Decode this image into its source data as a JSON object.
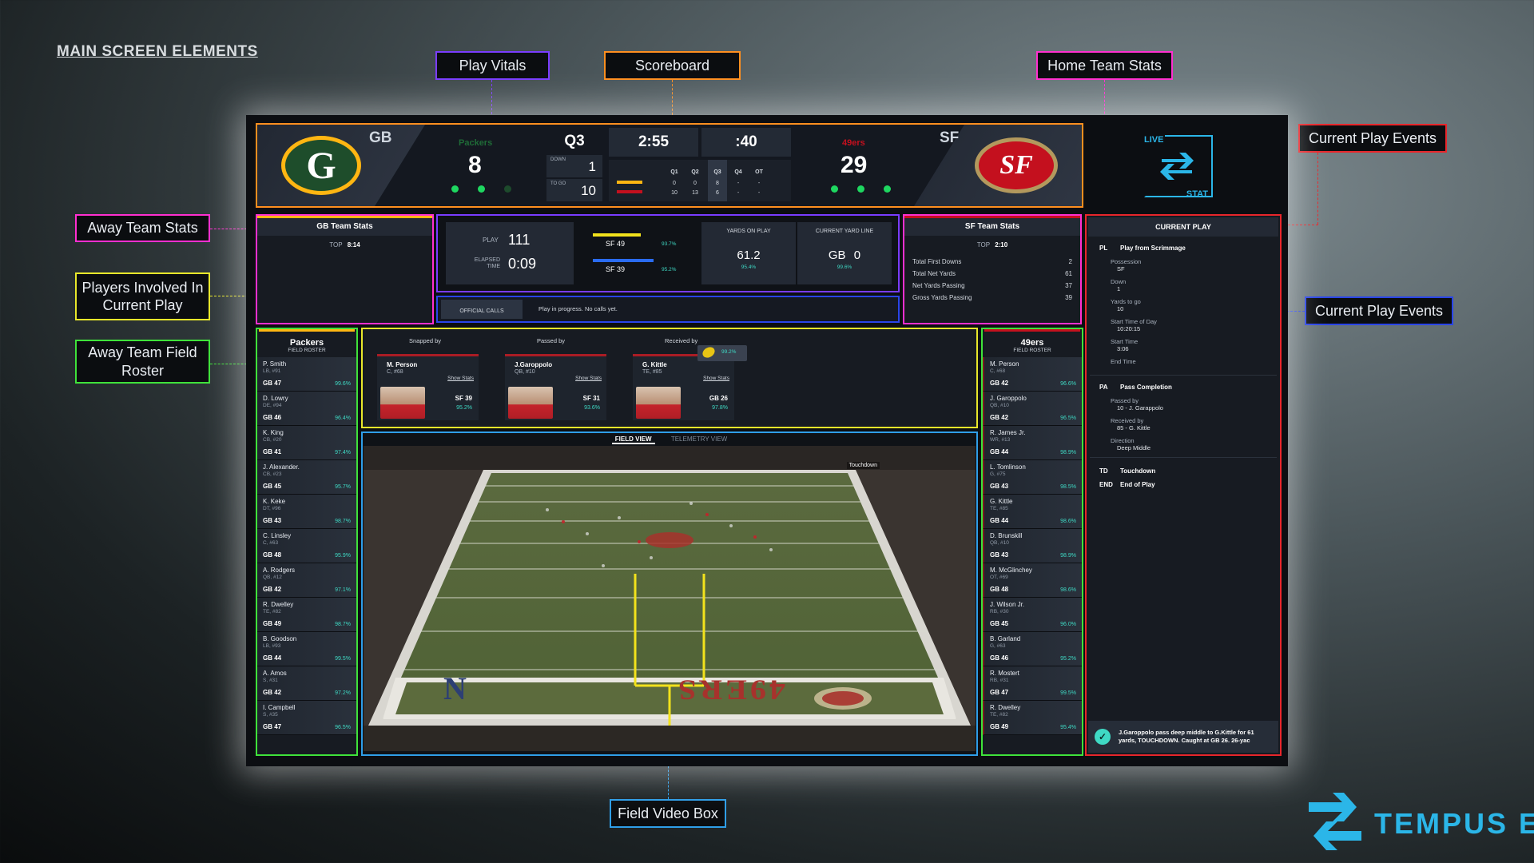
{
  "heading": "MAIN SCREEN ELEMENTS",
  "callouts": {
    "play_vitals": "Play Vitals",
    "scoreboard": "Scoreboard",
    "home_team_stats": "Home Team Stats",
    "current_play_events_top": "Current Play Events",
    "current_play_events_right": "Current Play Events",
    "away_team_stats": "Away Team Stats",
    "players_involved": "Players Involved In Current Play",
    "away_team_field_roster": "Away Team Field Roster",
    "field_video_box": "Field Video Box"
  },
  "colors": {
    "scoreboard": "#ff8f1f",
    "play_vitals": "#7a3cff",
    "team_stats": "#ff2fd0",
    "current_play": "#e8262b",
    "players_involved": "#e8e72a",
    "roster": "#3fe23a",
    "field_video": "#2f9ee8",
    "official_calls": "#2a45e8",
    "teal": "#3fd9c4"
  },
  "scoreboard": {
    "away": {
      "abbr": "GB",
      "name": "Packers",
      "score": "8",
      "logo_letter": "G"
    },
    "home": {
      "abbr": "SF",
      "name": "49ers",
      "score": "29",
      "logo_letter": "SF"
    },
    "quarter": "Q3",
    "down_label": "DOWN",
    "down": "1",
    "togo_label": "TO GO",
    "togo": "10",
    "game_clock": "2:55",
    "play_clock": ":40",
    "quarters_header": [
      "Q1",
      "Q2",
      "Q3",
      "Q4",
      "OT"
    ],
    "away_quarters": [
      "0",
      "0",
      "8",
      "-",
      "-"
    ],
    "home_quarters": [
      "10",
      "13",
      "6",
      "-",
      "-"
    ],
    "away_timeouts_remaining": 2,
    "home_timeouts_remaining": 3
  },
  "live_stat": {
    "top": "LIVE",
    "bottom": "STAT"
  },
  "away_stats": {
    "title": "GB Team Stats",
    "top_label": "TOP",
    "top_value": "8:14"
  },
  "home_stats": {
    "title": "SF Team Stats",
    "top_label": "TOP",
    "top_value": "2:10",
    "rows": [
      {
        "label": "Total First Downs",
        "value": "2"
      },
      {
        "label": "Total Net Yards",
        "value": "61"
      },
      {
        "label": "Net Yards Passing",
        "value": "37"
      },
      {
        "label": "Gross Yards Passing",
        "value": "39"
      }
    ]
  },
  "play_vitals": {
    "play_label": "PLAY",
    "play_value": "111",
    "elapsed_label": "ELAPSED TIME",
    "elapsed_value": "0:09",
    "bar1_label": "SF 49",
    "bar1_pct": "93.7%",
    "bar2_label": "SF 39",
    "bar2_pct": "95.2%",
    "yards_label": "YARDS ON PLAY",
    "yards_value": "61.2",
    "yards_pct": "95.4%",
    "yardline_label": "CURRENT YARD LINE",
    "yardline_team": "GB",
    "yardline_value": "0",
    "yardline_pct": "99.6%"
  },
  "official_calls": {
    "label": "OFFICIAL CALLS",
    "text": "Play in progress. No calls yet."
  },
  "players_involved": [
    {
      "role": "Snapped by",
      "name": "M. Person",
      "pos": "C, #68",
      "link": "Show Stats",
      "yl": "SF 39",
      "pct": "95.2%"
    },
    {
      "role": "Passed by",
      "name": "J.Garoppolo",
      "pos": "QB, #10",
      "link": "Show Stats",
      "yl": "SF 31",
      "pct": "93.6%"
    },
    {
      "role": "Received by",
      "name": "G. Kittle",
      "pos": "TE, #85",
      "link": "Show Stats",
      "yl": "GB 26",
      "pct": "97.8%",
      "ball_pct": "99.2%"
    }
  ],
  "field_view": {
    "tab_active": "FIELD VIEW",
    "tab_other": "TELEMETRY VIEW",
    "endzone_text": "49ERS",
    "nfc_text": "N",
    "overlay": "Touchdown"
  },
  "away_roster": {
    "team": "Packers",
    "subtitle": "FIELD ROSTER",
    "players": [
      {
        "name": "P. Smith",
        "pos": "LB, #91",
        "yl": "GB 47",
        "pct": "99.6%"
      },
      {
        "name": "D. Lowry",
        "pos": "DE, #94",
        "yl": "GB 46",
        "pct": "96.4%"
      },
      {
        "name": "K. King",
        "pos": "CB, #20",
        "yl": "GB 41",
        "pct": "97.4%"
      },
      {
        "name": "J. Alexander.",
        "pos": "CB, #23",
        "yl": "GB 45",
        "pct": "95.7%"
      },
      {
        "name": "K. Keke",
        "pos": "DT, #96",
        "yl": "GB 43",
        "pct": "98.7%"
      },
      {
        "name": "C. Linsley",
        "pos": "C, #63",
        "yl": "GB 48",
        "pct": "95.9%"
      },
      {
        "name": "A. Rodgers",
        "pos": "QB, #12",
        "yl": "GB 42",
        "pct": "97.1%"
      },
      {
        "name": "R. Dwelley",
        "pos": "TE, #82",
        "yl": "GB 49",
        "pct": "98.7%"
      },
      {
        "name": "B. Goodson",
        "pos": "LB, #93",
        "yl": "GB 44",
        "pct": "99.5%"
      },
      {
        "name": "A. Amos",
        "pos": "S, #31",
        "yl": "GB 42",
        "pct": "97.2%"
      },
      {
        "name": "I. Campbell",
        "pos": "S, #35",
        "yl": "GB 47",
        "pct": "96.5%"
      }
    ]
  },
  "home_roster": {
    "team": "49ers",
    "subtitle": "FIELD ROSTER",
    "players": [
      {
        "name": "M. Person",
        "pos": "C, #68",
        "yl": "GB 42",
        "pct": "96.6%"
      },
      {
        "name": "J. Garoppolo",
        "pos": "QB, #10",
        "yl": "GB 42",
        "pct": "96.5%"
      },
      {
        "name": "R. James Jr.",
        "pos": "WR, #13",
        "yl": "GB 44",
        "pct": "98.9%"
      },
      {
        "name": "L. Tomlinson",
        "pos": "G, #75",
        "yl": "GB 43",
        "pct": "98.5%"
      },
      {
        "name": "G. Kittle",
        "pos": "TE, #85",
        "yl": "GB 44",
        "pct": "98.6%"
      },
      {
        "name": "D. Brunskill",
        "pos": "QB, #10",
        "yl": "GB 43",
        "pct": "98.9%"
      },
      {
        "name": "M. McGlinchey",
        "pos": "OT, #69",
        "yl": "GB 48",
        "pct": "98.6%"
      },
      {
        "name": "J. Wilson Jr.",
        "pos": "RB, #30",
        "yl": "GB 45",
        "pct": "96.0%"
      },
      {
        "name": "B. Garland",
        "pos": "G, #63",
        "yl": "GB 46",
        "pct": "95.2%"
      },
      {
        "name": "R. Mostert",
        "pos": "RB, #31",
        "yl": "GB 47",
        "pct": "99.5%"
      },
      {
        "name": "R. Dwelley",
        "pos": "TE, #82",
        "yl": "GB 49",
        "pct": "95.4%"
      }
    ]
  },
  "current_play": {
    "title": "CURRENT PLAY",
    "pl_code": "PL",
    "pl_title": "Play from Scrimmage",
    "fields": [
      {
        "label": "Possession",
        "value": "SF"
      },
      {
        "label": "Down",
        "value": "1"
      },
      {
        "label": "Yards to go",
        "value": "10"
      },
      {
        "label": "Start Time of Day",
        "value": "10:20:15"
      },
      {
        "label": "Start Time",
        "value": "3:06"
      },
      {
        "label": "End Time",
        "value": ""
      }
    ],
    "pa_code": "PA",
    "pa_title": "Pass Completion",
    "pa_fields": [
      {
        "label": "Passed by",
        "value": "10 - J. Garappolo"
      },
      {
        "label": "Received by",
        "value": "85 - G. Kittle"
      },
      {
        "label": "Direction",
        "value": "Deep Middle"
      }
    ],
    "td_code": "TD",
    "td_title": "Touchdown",
    "end_code": "END",
    "end_title": "End of Play",
    "summary": "J.Garoppolo pass deep middle to G.Kittle for 61 yards, TOUCHDOWN. Caught at GB 26. 26-yac"
  },
  "brand": "TEMPUS EX"
}
